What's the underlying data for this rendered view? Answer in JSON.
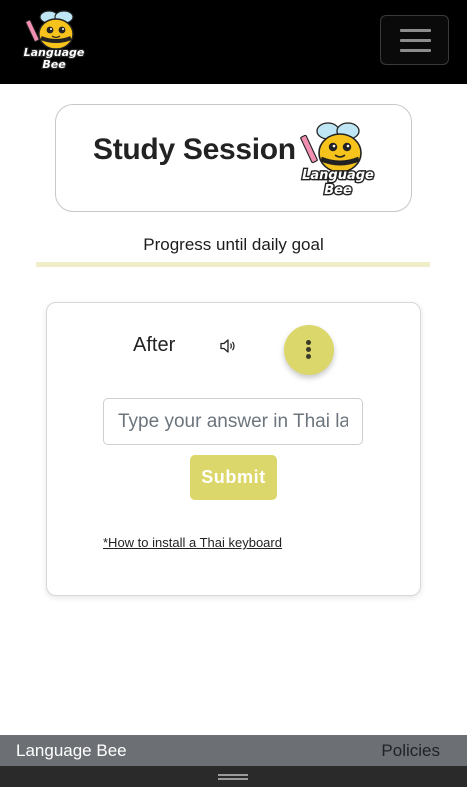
{
  "navbar": {
    "logo_alt": "Language Bee",
    "logo_text": "Language Bee",
    "toggle_icon": "hamburger-menu-icon"
  },
  "header": {
    "title": "Study Session",
    "logo_text": "Language Bee"
  },
  "progress": {
    "label": "Progress until daily goal",
    "fraction": 0.0,
    "colors": {
      "track": "#f0edc9",
      "fill": "#d9d36a"
    }
  },
  "quiz": {
    "prompt_word": "After",
    "speaker_icon": "speaker-icon",
    "menu_icon": "vertical-dots-icon",
    "answer": {
      "value": "",
      "placeholder": "Type your answer in Thai language"
    },
    "submit_label": "Submit",
    "keyboard_link": "*How to install a Thai keyboard"
  },
  "footer": {
    "brand": "Language Bee",
    "policies": "Policies"
  },
  "colors": {
    "accent": "#dcd76a",
    "navbar_bg": "#000000",
    "footer_bg": "#6c7075"
  }
}
